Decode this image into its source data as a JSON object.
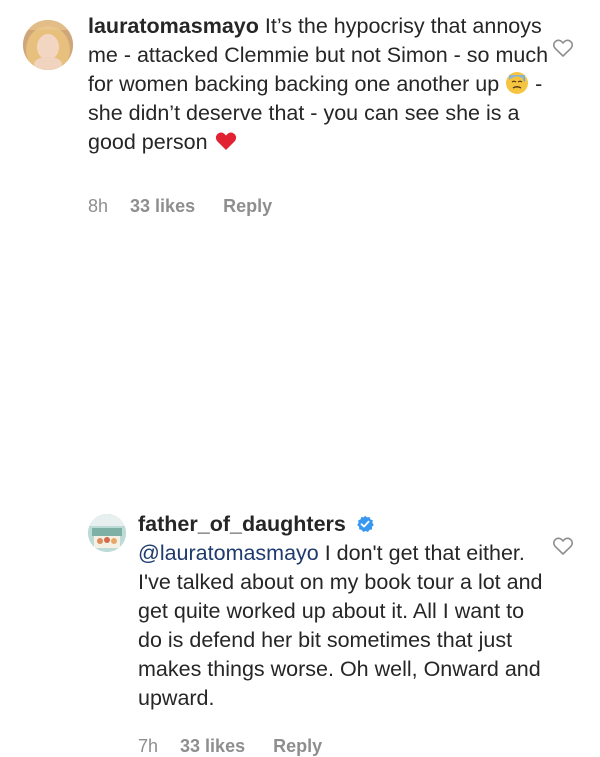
{
  "comments": [
    {
      "username": "lauratomasmayo",
      "text_part1": "It’s the hypocrisy that annoys me - attacked  Clemmie but not Simon - so much for women backing backing one another up",
      "emoji1": "downcast-face-with-sweat",
      "text_part2": " - she didn’t deserve that - you can see she is a good person",
      "emoji2": "red-heart",
      "time": "8h",
      "likes": "33 likes",
      "reply": "Reply"
    },
    {
      "username": "father_of_daughters",
      "verified": true,
      "mention": "@lauratomasmayo",
      "text": " I don't get that either. I've talked about on my book tour a lot and get quite worked up about it. All I want to do is defend her bit sometimes that just makes things worse.  Oh well, Onward and upward.",
      "time": "7h",
      "likes": "33 likes",
      "reply": "Reply"
    }
  ],
  "colors": {
    "text": "#262626",
    "muted": "#8e8e8e",
    "mention": "#1e3a6e",
    "verified": "#3897f0"
  }
}
